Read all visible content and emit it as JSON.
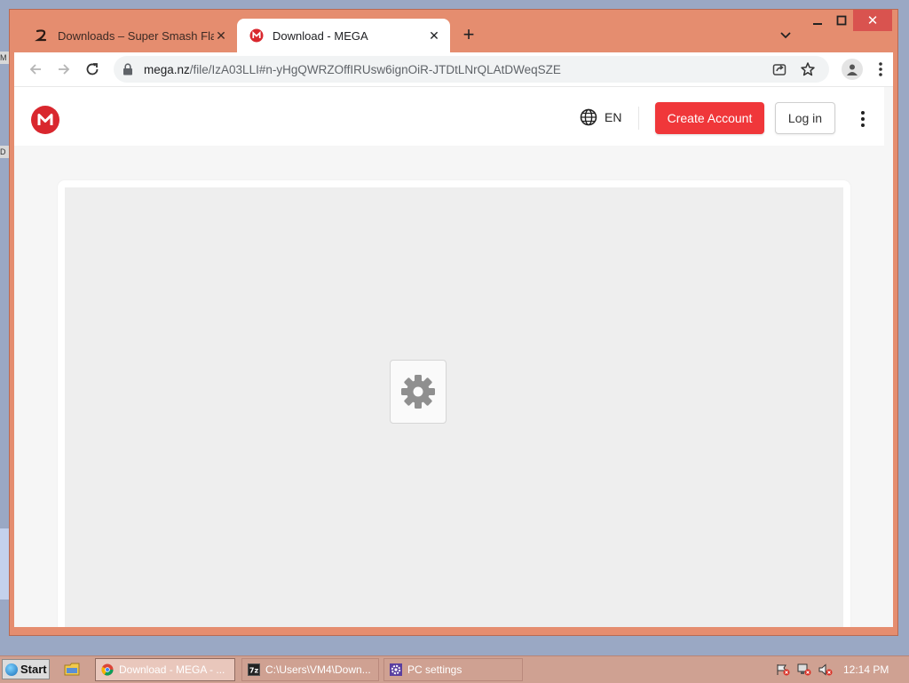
{
  "tabs": [
    {
      "title": "Downloads – Super Smash Flash",
      "active": false
    },
    {
      "title": "Download - MEGA",
      "active": true
    }
  ],
  "address_bar": {
    "host": "mega.nz",
    "path": "/file/IzA03LLI#n-yHgQWRZOffIRUsw6ignOiR-JTDtLNrQLAtDWeqSZE"
  },
  "mega_header": {
    "language": "EN",
    "create_account_label": "Create Account",
    "login_label": "Log in"
  },
  "desktop": {
    "fragments": [
      "M",
      "D"
    ]
  },
  "taskbar": {
    "start_label": "Start",
    "items": [
      {
        "label": "Download - MEGA - ..."
      },
      {
        "label": "C:\\Users\\VM4\\Down..."
      },
      {
        "label": "PC settings"
      }
    ],
    "clock": "12:14 PM"
  },
  "colors": {
    "window_frame": "#e58d6f",
    "mega_red": "#d9272e",
    "create_button": "#f0373a",
    "taskbar": "#cfa192"
  }
}
